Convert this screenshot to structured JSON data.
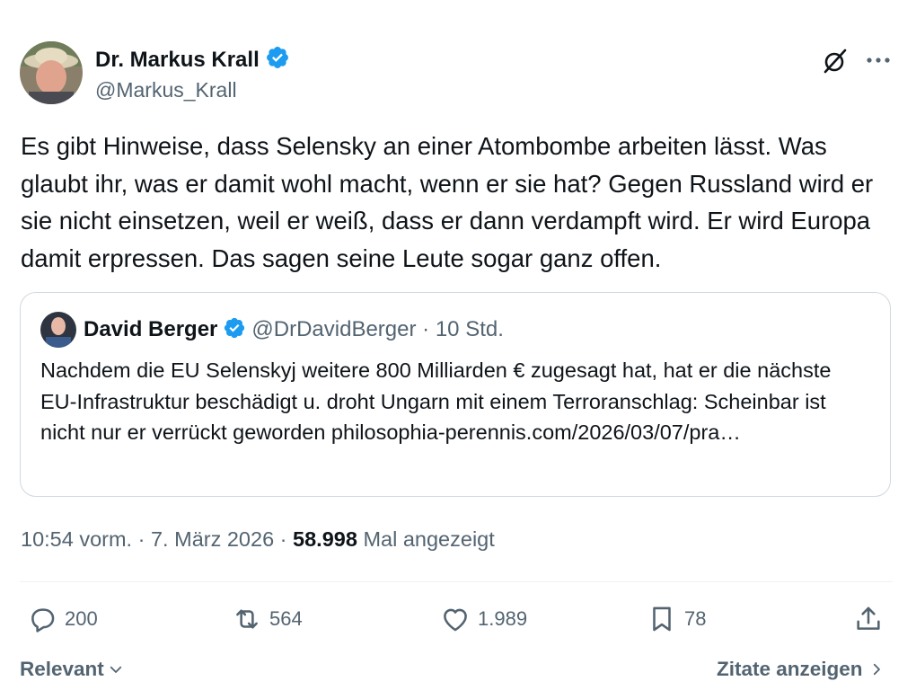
{
  "tweet": {
    "author_name": "Dr. Markus Krall",
    "author_handle": "@Markus_Krall",
    "text": "Es gibt Hinweise, dass Selensky an einer Atombombe arbeiten lässt. Was glaubt ihr, was er damit wohl macht, wenn er sie hat? Gegen Russland wird er sie nicht einsetzen, weil er weiß, dass er dann verdampft wird. Er wird Europa damit erpressen. Das sagen seine Leute sogar ganz offen.",
    "icons": {
      "verified": "verified-badge-icon",
      "grok": "grok-icon",
      "more": "more-icon"
    }
  },
  "quote": {
    "author_name": "David Berger",
    "author_handle": "@DrDavidBerger",
    "separator": "·",
    "time": "10 Std.",
    "text": "Nachdem die EU Selenskyj weitere 800 Milliarden € zugesagt hat, hat er die nächste EU-Infrastruktur beschädigt u. droht Ungarn mit einem Terroranschlag: Scheinbar ist nicht nur er verrückt geworden philosophia-perennis.com/2026/03/07/pra…"
  },
  "meta": {
    "time": "10:54 vorm.",
    "sep1": "·",
    "date": "7. März 2026",
    "sep2": "·",
    "views_count": "58.998",
    "views_label": "Mal angezeigt"
  },
  "actions": {
    "replies": "200",
    "reposts": "564",
    "likes": "1.989",
    "bookmarks": "78"
  },
  "footer": {
    "sort_label": "Relevant",
    "quotes_link": "Zitate anzeigen"
  },
  "colors": {
    "text": "#0f1419",
    "muted": "#536471",
    "verified": "#1d9bf0",
    "border": "#cfd9de"
  }
}
